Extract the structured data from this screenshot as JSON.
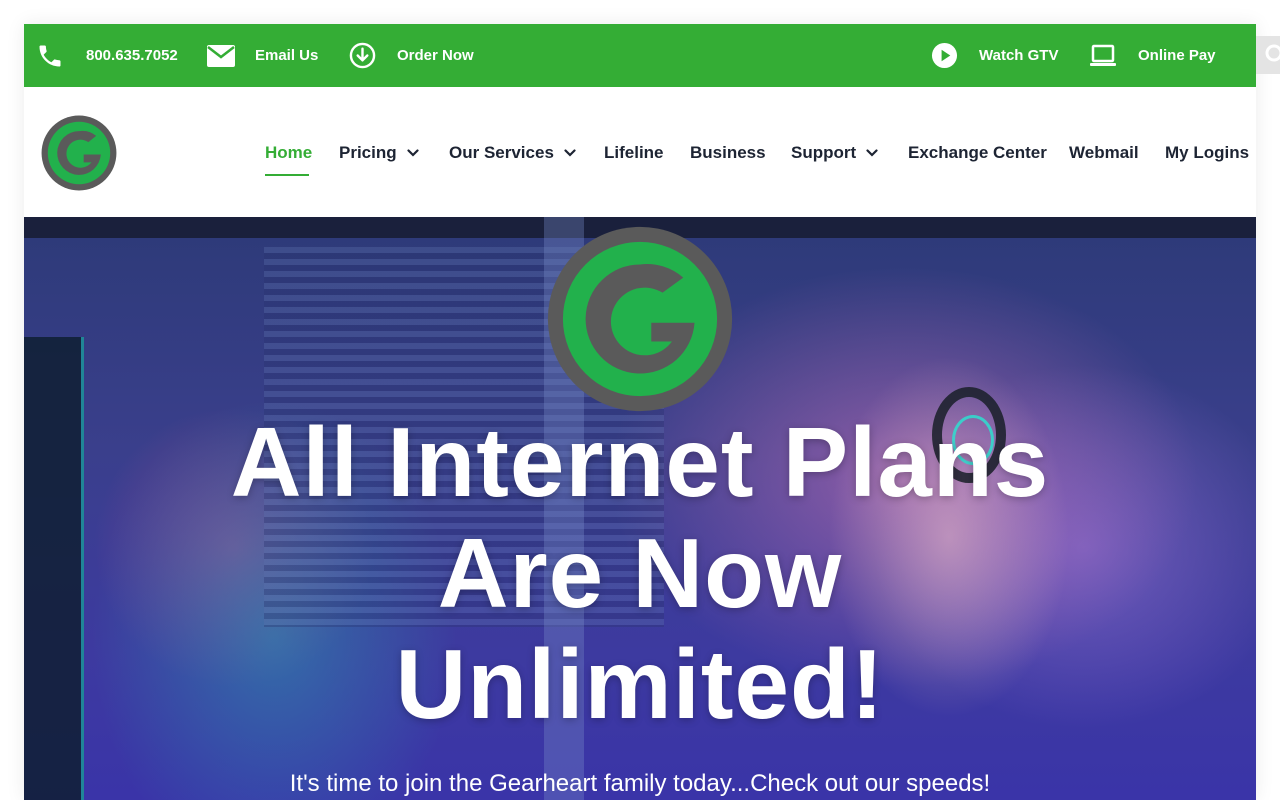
{
  "topbar": {
    "phone": "800.635.7052",
    "email": "Email Us",
    "order": "Order Now",
    "watch": "Watch GTV",
    "pay": "Online Pay"
  },
  "nav": {
    "items": [
      {
        "label": "Home",
        "active": true,
        "dropdown": false
      },
      {
        "label": "Pricing",
        "dropdown": true
      },
      {
        "label": "Our Services",
        "dropdown": true
      },
      {
        "label": "Lifeline",
        "dropdown": false
      },
      {
        "label": "Business",
        "dropdown": false
      },
      {
        "label": "Support",
        "dropdown": true
      },
      {
        "label": "Exchange Center",
        "dropdown": false
      },
      {
        "label": "Webmail",
        "dropdown": false
      },
      {
        "label": "My Logins",
        "dropdown": false
      }
    ]
  },
  "hero": {
    "title_line1": "All Internet Plans",
    "title_line2": "Are Now",
    "title_line3": "Unlimited!",
    "subtitle": "It's time to join the Gearheart family today...Check out our speeds!"
  },
  "colors": {
    "brand_green": "#34ad35",
    "logo_green": "#22b14c",
    "logo_gray": "#5a5a5a",
    "nav_text": "#1d2433"
  },
  "icons": {
    "phone": "phone-icon",
    "email": "envelope-icon",
    "order": "download-circle-icon",
    "watch": "play-circle-icon",
    "pay": "laptop-icon",
    "search": "search-icon",
    "dropdown": "chevron-down-icon"
  }
}
